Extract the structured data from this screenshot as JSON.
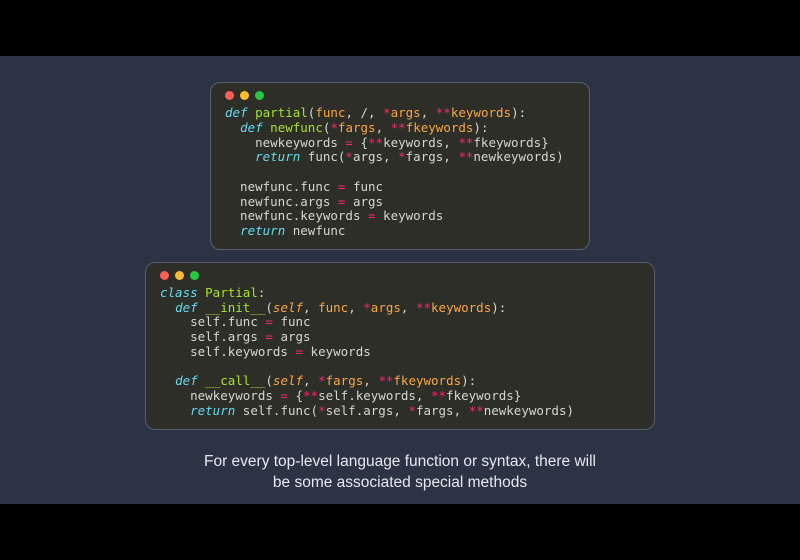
{
  "caption": {
    "line1": "For every top-level language function or syntax, there will",
    "line2": "be some associated special methods"
  },
  "window1": {
    "tokens": [
      [
        [
          "kw",
          "def "
        ],
        [
          "fn",
          "partial"
        ],
        [
          "pu",
          "("
        ],
        [
          "pr",
          "func"
        ],
        [
          "pu",
          ", /, "
        ],
        [
          "op",
          "*"
        ],
        [
          "pr",
          "args"
        ],
        [
          "pu",
          ", "
        ],
        [
          "op",
          "**"
        ],
        [
          "pr",
          "keywords"
        ],
        [
          "pu",
          "):"
        ]
      ],
      [
        [
          "pl",
          "  "
        ],
        [
          "kw",
          "def "
        ],
        [
          "fn",
          "newfunc"
        ],
        [
          "pu",
          "("
        ],
        [
          "op",
          "*"
        ],
        [
          "pr",
          "fargs"
        ],
        [
          "pu",
          ", "
        ],
        [
          "op",
          "**"
        ],
        [
          "pr",
          "fkeywords"
        ],
        [
          "pu",
          "):"
        ]
      ],
      [
        [
          "pl",
          "    newkeywords "
        ],
        [
          "op",
          "="
        ],
        [
          "pl",
          " {"
        ],
        [
          "op",
          "**"
        ],
        [
          "pl",
          "keywords, "
        ],
        [
          "op",
          "**"
        ],
        [
          "pl",
          "fkeywords}"
        ]
      ],
      [
        [
          "pl",
          "    "
        ],
        [
          "kw",
          "return"
        ],
        [
          "pl",
          " func("
        ],
        [
          "op",
          "*"
        ],
        [
          "pl",
          "args, "
        ],
        [
          "op",
          "*"
        ],
        [
          "pl",
          "fargs, "
        ],
        [
          "op",
          "**"
        ],
        [
          "pl",
          "newkeywords)"
        ]
      ],
      [
        [
          "pl",
          " "
        ]
      ],
      [
        [
          "pl",
          "  newfunc"
        ],
        [
          "pu",
          "."
        ],
        [
          "pl",
          "func "
        ],
        [
          "op",
          "="
        ],
        [
          "pl",
          " func"
        ]
      ],
      [
        [
          "pl",
          "  newfunc"
        ],
        [
          "pu",
          "."
        ],
        [
          "pl",
          "args "
        ],
        [
          "op",
          "="
        ],
        [
          "pl",
          " args"
        ]
      ],
      [
        [
          "pl",
          "  newfunc"
        ],
        [
          "pu",
          "."
        ],
        [
          "pl",
          "keywords "
        ],
        [
          "op",
          "="
        ],
        [
          "pl",
          " keywords"
        ]
      ],
      [
        [
          "pl",
          "  "
        ],
        [
          "kw",
          "return"
        ],
        [
          "pl",
          " newfunc"
        ]
      ]
    ]
  },
  "window2": {
    "tokens": [
      [
        [
          "kw",
          "class "
        ],
        [
          "cls",
          "Partial"
        ],
        [
          "pu",
          ":"
        ]
      ],
      [
        [
          "pl",
          "  "
        ],
        [
          "kw",
          "def "
        ],
        [
          "fn",
          "__init__"
        ],
        [
          "pu",
          "("
        ],
        [
          "slf",
          "self"
        ],
        [
          "pu",
          ", "
        ],
        [
          "pr",
          "func"
        ],
        [
          "pu",
          ", "
        ],
        [
          "op",
          "*"
        ],
        [
          "pr",
          "args"
        ],
        [
          "pu",
          ", "
        ],
        [
          "op",
          "**"
        ],
        [
          "pr",
          "keywords"
        ],
        [
          "pu",
          "):"
        ]
      ],
      [
        [
          "pl",
          "    self"
        ],
        [
          "pu",
          "."
        ],
        [
          "pl",
          "func "
        ],
        [
          "op",
          "="
        ],
        [
          "pl",
          " func"
        ]
      ],
      [
        [
          "pl",
          "    self"
        ],
        [
          "pu",
          "."
        ],
        [
          "pl",
          "args "
        ],
        [
          "op",
          "="
        ],
        [
          "pl",
          " args"
        ]
      ],
      [
        [
          "pl",
          "    self"
        ],
        [
          "pu",
          "."
        ],
        [
          "pl",
          "keywords "
        ],
        [
          "op",
          "="
        ],
        [
          "pl",
          " keywords"
        ]
      ],
      [
        [
          "pl",
          " "
        ]
      ],
      [
        [
          "pl",
          "  "
        ],
        [
          "kw",
          "def "
        ],
        [
          "fn",
          "__call__"
        ],
        [
          "pu",
          "("
        ],
        [
          "slf",
          "self"
        ],
        [
          "pu",
          ", "
        ],
        [
          "op",
          "*"
        ],
        [
          "pr",
          "fargs"
        ],
        [
          "pu",
          ", "
        ],
        [
          "op",
          "**"
        ],
        [
          "pr",
          "fkeywords"
        ],
        [
          "pu",
          "):"
        ]
      ],
      [
        [
          "pl",
          "    newkeywords "
        ],
        [
          "op",
          "="
        ],
        [
          "pl",
          " {"
        ],
        [
          "op",
          "**"
        ],
        [
          "pl",
          "self"
        ],
        [
          "pu",
          "."
        ],
        [
          "pl",
          "keywords, "
        ],
        [
          "op",
          "**"
        ],
        [
          "pl",
          "fkeywords}"
        ]
      ],
      [
        [
          "pl",
          "    "
        ],
        [
          "kw",
          "return"
        ],
        [
          "pl",
          " self"
        ],
        [
          "pu",
          "."
        ],
        [
          "pl",
          "func("
        ],
        [
          "op",
          "*"
        ],
        [
          "pl",
          "self"
        ],
        [
          "pu",
          "."
        ],
        [
          "pl",
          "args, "
        ],
        [
          "op",
          "*"
        ],
        [
          "pl",
          "fargs, "
        ],
        [
          "op",
          "**"
        ],
        [
          "pl",
          "newkeywords)"
        ]
      ]
    ]
  }
}
